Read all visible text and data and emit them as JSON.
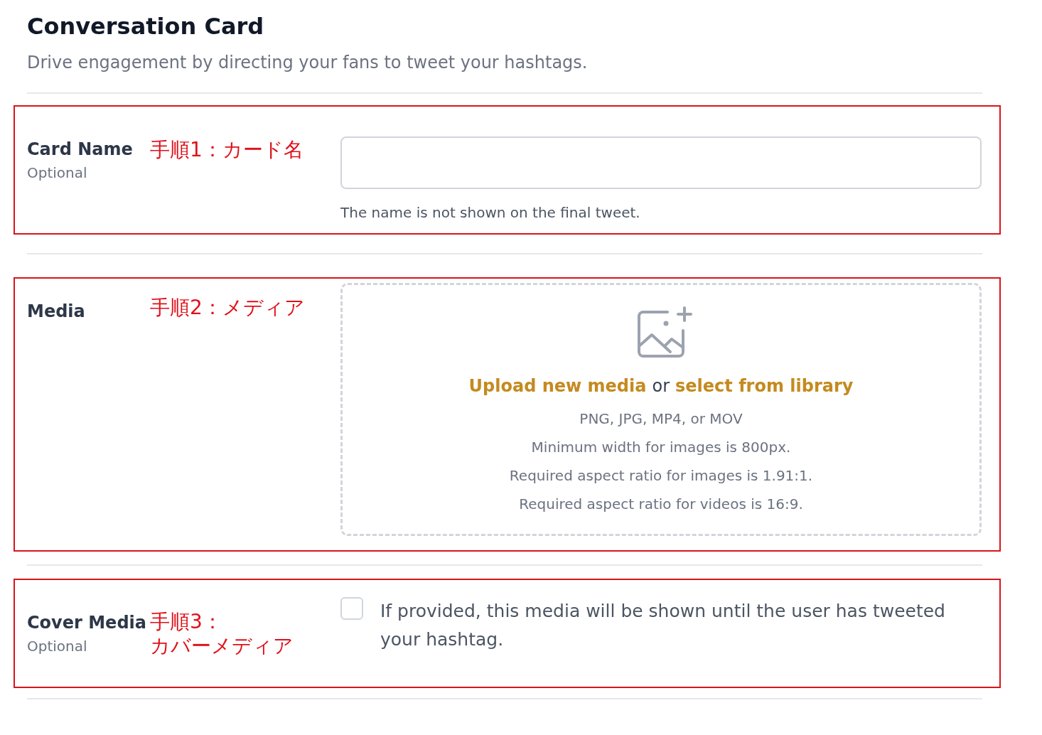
{
  "title": "Conversation Card",
  "subtitle": "Drive engagement by directing your fans to tweet your hashtags.",
  "sections": [
    {
      "kind": "text",
      "label": "Card Name",
      "sublabel": "Optional",
      "note": [
        "手順1：カード名"
      ],
      "help": "The name is not shown on the final tweet."
    },
    {
      "kind": "upload",
      "label": "Media",
      "note": [
        "手順2：メディア"
      ],
      "upload_link": "Upload new media",
      "joiner": "or",
      "library_link": "select from library",
      "requirements": [
        "PNG, JPG, MP4, or MOV",
        "Minimum width for images is 800px.",
        "Required aspect ratio for images is 1.91:1.",
        "Required aspect ratio for videos is 16:9."
      ]
    },
    {
      "kind": "checkbox",
      "label": "Cover Media",
      "sublabel": "Optional",
      "note": [
        "手順3：",
        "カバーメディア"
      ],
      "checked": false,
      "description": "If provided, this media will be shown until the user has tweeted your hashtag."
    }
  ]
}
